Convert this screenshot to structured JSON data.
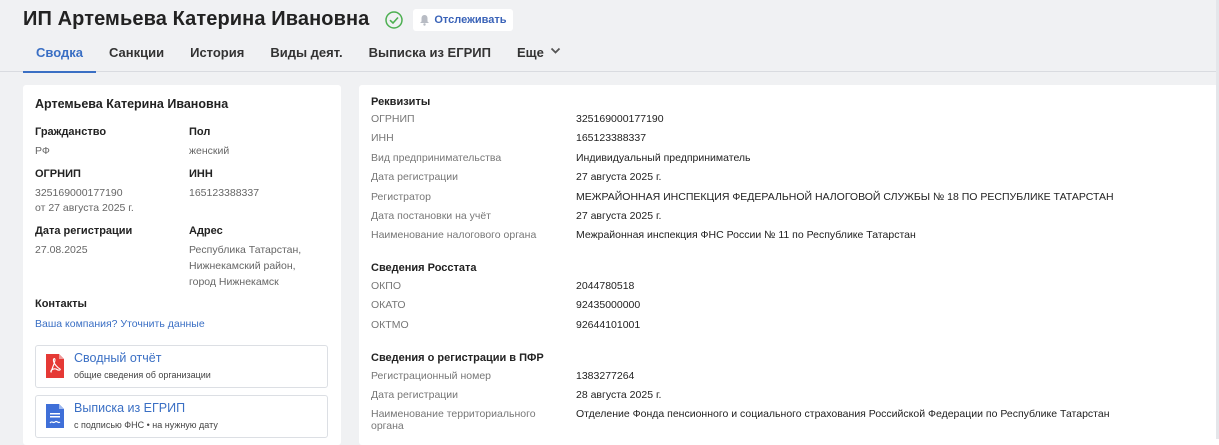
{
  "header": {
    "title": "ИП Артемьева Катерина Ивановна",
    "track_label": "Отслеживать"
  },
  "tabs": [
    {
      "label": "Сводка",
      "active": true
    },
    {
      "label": "Санкции"
    },
    {
      "label": "История"
    },
    {
      "label": "Виды деят."
    },
    {
      "label": "Выписка из ЕГРИП"
    },
    {
      "label": "Еще"
    }
  ],
  "left": {
    "name": "Артемьева Катерина Ивановна",
    "citizenship_label": "Гражданство",
    "citizenship_value": "РФ",
    "gender_label": "Пол",
    "gender_value": "женский",
    "ogrnip_label": "ОГРНИП",
    "ogrnip_value": "325169000177190",
    "ogrnip_date": "от 27 августа 2025 г.",
    "inn_label": "ИНН",
    "inn_value": "165123388337",
    "regdate_label": "Дата регистрации",
    "regdate_value": "27.08.2025",
    "address_label": "Адрес",
    "address_line1": "Республика Татарстан,",
    "address_line2": "Нижнекамский район,",
    "address_line3": "город Нижнекамск",
    "contacts_label": "Контакты",
    "contacts_link": "Ваша компания? Уточнить данные",
    "docs": [
      {
        "title": "Сводный отчёт",
        "subtitle": "общие сведения об организации",
        "icon": "pdf-icon"
      },
      {
        "title": "Выписка из ЕГРИП",
        "subtitle": "с подписью ФНС • на нужную дату",
        "icon": "document-icon"
      }
    ]
  },
  "right": {
    "requisites_title": "Реквизиты",
    "requisites": [
      {
        "k": "ОГРНИП",
        "v": "325169000177190"
      },
      {
        "k": "ИНН",
        "v": "165123388337"
      },
      {
        "k": "Вид предпринимательства",
        "v": "Индивидуальный предприниматель"
      },
      {
        "k": "Дата регистрации",
        "v": "27 августа 2025 г."
      },
      {
        "k": "Регистратор",
        "v": "МЕЖРАЙОННАЯ ИНСПЕКЦИЯ ФЕДЕРАЛЬНОЙ НАЛОГОВОЙ СЛУЖБЫ № 18 ПО РЕСПУБЛИКЕ ТАТАРСТАН"
      },
      {
        "k": "Дата постановки на учёт",
        "v": "27 августа 2025 г."
      },
      {
        "k": "Наименование налогового органа",
        "v": "Межрайонная инспекция ФНС России № 11 по Республике Татарстан"
      }
    ],
    "rosstat_title": "Сведения Росстата",
    "rosstat": [
      {
        "k": "ОКПО",
        "v": "2044780518"
      },
      {
        "k": "ОКАТО",
        "v": "92435000000"
      },
      {
        "k": "ОКТМО",
        "v": "92644101001"
      }
    ],
    "pfr_title": "Сведения о регистрации в ПФР",
    "pfr": [
      {
        "k": "Регистрационный номер",
        "v": "1383277264"
      },
      {
        "k": "Дата регистрации",
        "v": "28 августа 2025 г."
      },
      {
        "k": "Наименование территориального органа",
        "v": "Отделение Фонда пенсионного и социального страхования Российской Федерации по Республике Татарстан"
      }
    ]
  }
}
